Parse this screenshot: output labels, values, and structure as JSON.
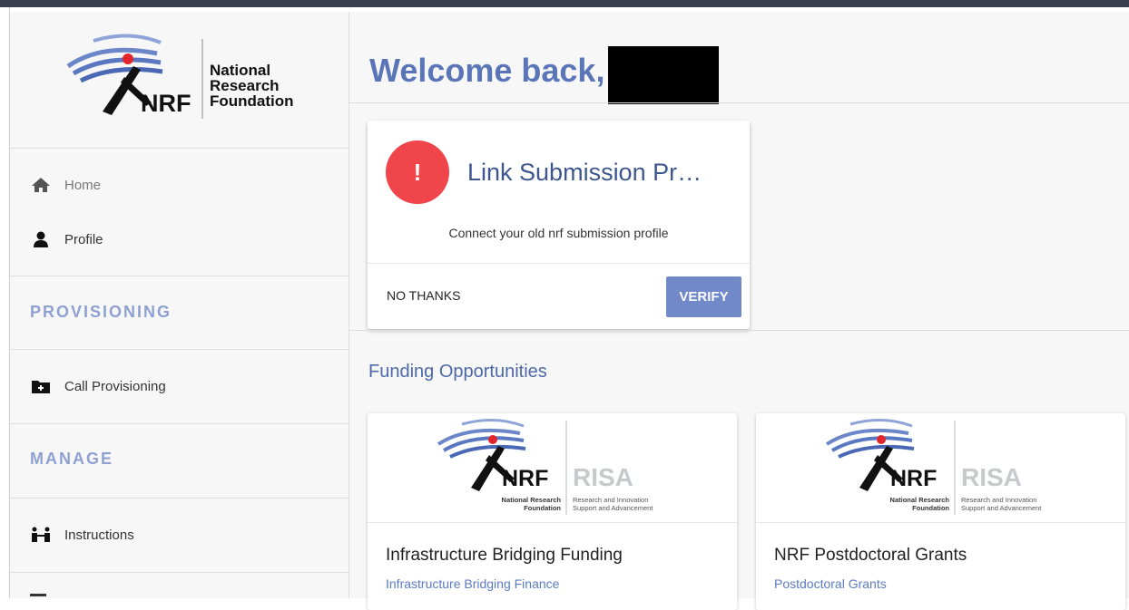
{
  "sidebar": {
    "logo": {
      "line1": "National",
      "line2": "Research",
      "line3": "Foundation",
      "mark": "NRF"
    },
    "items": {
      "home": {
        "label": "Home",
        "icon": "home-icon"
      },
      "profile": {
        "label": "Profile",
        "icon": "person-icon"
      },
      "call_provisioning": {
        "label": "Call Provisioning",
        "icon": "folder-plus-icon"
      },
      "instructions": {
        "label": "Instructions",
        "icon": "people-icon"
      }
    },
    "sections": {
      "provisioning": "PROVISIONING",
      "manage": "MANAGE"
    }
  },
  "main": {
    "welcome": "Welcome back,",
    "alert_card": {
      "icon_text": "!",
      "title": "Link Submission Pr…",
      "description": "Connect your old nrf submission profile",
      "no_thanks": "NO THANKS",
      "verify": "VERIFY"
    },
    "funding_title": "Funding Opportunities",
    "funding_cards": [
      {
        "name": "Infrastructure Bridging Funding",
        "subtitle": "Infrastructure Bridging Finance"
      },
      {
        "name": "NRF Postdoctoral Grants",
        "subtitle": "Postdoctoral Grants"
      }
    ],
    "risa_logo": {
      "mark": "NRF",
      "risa": "RISA",
      "left_line1": "National Research",
      "left_line2": "Foundation",
      "right_line1": "Research and Innovation",
      "right_line2": "Support and Advancement"
    }
  },
  "colors": {
    "accent": "#5a76b8",
    "verify": "#7189c9",
    "alert": "#f0454a",
    "section": "#8ea1d2"
  }
}
